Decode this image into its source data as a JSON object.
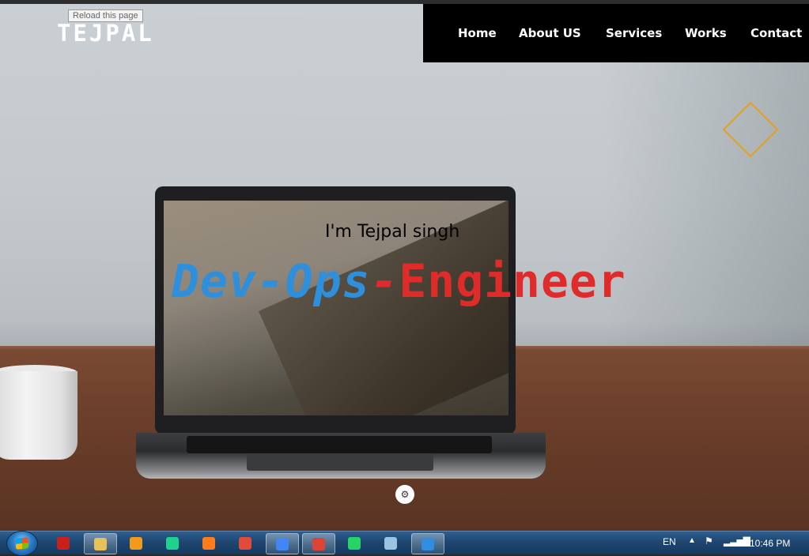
{
  "tooltip": "Reload this page",
  "logo": "TEJPAL",
  "nav": {
    "items": [
      "Home",
      "About US",
      "Services",
      "Works",
      "Contact"
    ]
  },
  "hero": {
    "intro": "I'm Tejpal singh",
    "headline_part1": "Dev-Ops",
    "headline_sep": "-",
    "headline_part2": "Engineer",
    "colors": {
      "blue": "#2e8fdc",
      "red": "#e02b2b",
      "accent": "#e2a11e",
      "nav_bg": "#000000"
    }
  },
  "taskbar": {
    "apps": [
      {
        "name": "pdf-reader-icon",
        "color": "#c9201e"
      },
      {
        "name": "file-explorer-icon",
        "color": "#e7c25a",
        "active": true
      },
      {
        "name": "media-player-icon",
        "color": "#f29a1c"
      },
      {
        "name": "pycharm-icon",
        "color": "#1fd18d"
      },
      {
        "name": "firefox-icon",
        "color": "#ff7b1c"
      },
      {
        "name": "snipping-tool-icon",
        "color": "#e24a3a"
      },
      {
        "name": "chrome-icon",
        "color": "#4285f4",
        "active": true
      },
      {
        "name": "chrome-icon-2",
        "color": "#db4437",
        "active": true
      },
      {
        "name": "whatsapp-icon",
        "color": "#25d366"
      },
      {
        "name": "notepad-icon",
        "color": "#9bc4e2"
      },
      {
        "name": "vscode-icon",
        "color": "#2f8ee0",
        "active": true
      }
    ],
    "language": "EN",
    "time": "10:46 PM"
  }
}
